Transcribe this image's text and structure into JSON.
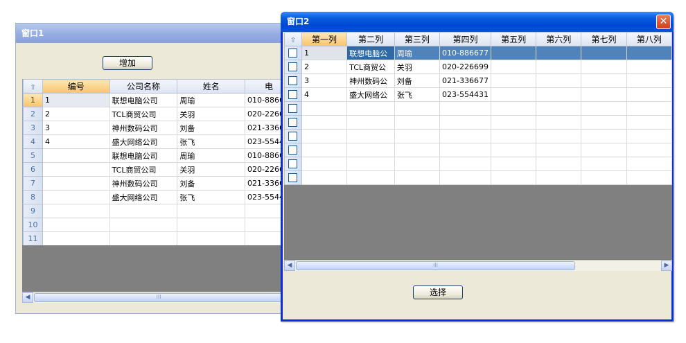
{
  "window1": {
    "title": "窗口1",
    "add_button": "增加",
    "columns": [
      "编号",
      "公司名称",
      "姓名",
      "电"
    ],
    "rows": [
      [
        "1",
        "1",
        "联想电脑公司",
        "周瑜",
        "010-8866"
      ],
      [
        "2",
        "2",
        "TCL商贸公司",
        "关羽",
        "020-2266"
      ],
      [
        "3",
        "3",
        "神州数码公司",
        "刘备",
        "021-3366"
      ],
      [
        "4",
        "4",
        "盛大网络公司",
        "张飞",
        "023-5544"
      ],
      [
        "5",
        "",
        "联想电脑公司",
        "周瑜",
        "010-8866"
      ],
      [
        "6",
        "",
        "TCL商贸公司",
        "关羽",
        "020-2266"
      ],
      [
        "7",
        "",
        "神州数码公司",
        "刘备",
        "021-3366"
      ],
      [
        "8",
        "",
        "盛大网络公司",
        "张飞",
        "023-5544"
      ],
      [
        "9",
        "",
        "",
        "",
        ""
      ],
      [
        "10",
        "",
        "",
        "",
        ""
      ],
      [
        "11",
        "",
        "",
        "",
        ""
      ]
    ],
    "scroll_thumb_label": "III"
  },
  "window2": {
    "title": "窗口2",
    "close_glyph": "✕",
    "select_button": "选择",
    "columns": [
      "第一列",
      "第二列",
      "第三列",
      "第四列",
      "第五列",
      "第六列",
      "第七列",
      "第八列"
    ],
    "rows": [
      [
        "1",
        "联想电脑公",
        "周瑜",
        "010-886677",
        "",
        "",
        "",
        ""
      ],
      [
        "2",
        "TCL商贸公",
        "关羽",
        "020-226699",
        "",
        "",
        "",
        ""
      ],
      [
        "3",
        "神州数码公",
        "刘备",
        "021-336677",
        "",
        "",
        "",
        ""
      ],
      [
        "4",
        "盛大网络公",
        "张飞",
        "023-554431",
        "",
        "",
        "",
        ""
      ],
      [
        "",
        "",
        "",
        "",
        "",
        "",
        "",
        ""
      ],
      [
        "",
        "",
        "",
        "",
        "",
        "",
        "",
        ""
      ],
      [
        "",
        "",
        "",
        "",
        "",
        "",
        "",
        ""
      ],
      [
        "",
        "",
        "",
        "",
        "",
        "",
        "",
        ""
      ],
      [
        "",
        "",
        "",
        "",
        "",
        "",
        "",
        ""
      ],
      [
        "",
        "",
        "",
        "",
        "",
        "",
        "",
        ""
      ]
    ],
    "scroll_thumb_label": "III"
  }
}
